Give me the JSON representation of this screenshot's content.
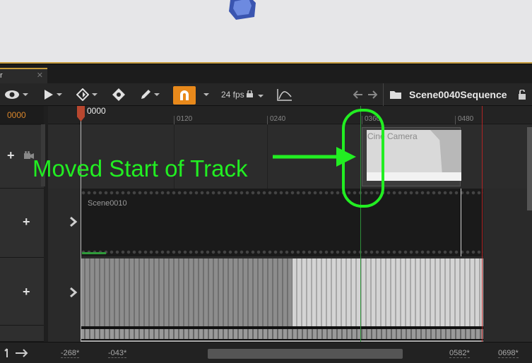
{
  "tab": {
    "title": "r",
    "close": "✕"
  },
  "toolbar": {
    "fps_label": "24 fps",
    "sequence_name": "Scene0040Sequence"
  },
  "left": {
    "frame": "0000"
  },
  "ruler": {
    "playhead": "0000",
    "ticks": [
      "0120",
      "0240",
      "0360",
      "0480"
    ]
  },
  "tracks": {
    "camera_label": "Cine Camera",
    "shot_label": "Scene0010"
  },
  "bottom": {
    "range_start": "-268*",
    "view_start": "-043*",
    "view_end": "0582*",
    "range_end": "0698*"
  },
  "annotation": {
    "text": "Moved Start of Track",
    "color": "#22ee22"
  },
  "colors": {
    "accent": "#e8891b",
    "frame_text": "#d9862c",
    "end_marker": "#b02424",
    "start_marker": "#2e8f3a"
  },
  "icons": [
    "eye-icon",
    "play-icon",
    "key-icon",
    "transform-icon",
    "pencil-icon",
    "magnet-icon",
    "curve-icon",
    "back-arrow-icon",
    "forward-arrow-icon",
    "folder-icon",
    "lock-icon",
    "camera-icon",
    "plus-icon",
    "chevron-right-icon"
  ]
}
